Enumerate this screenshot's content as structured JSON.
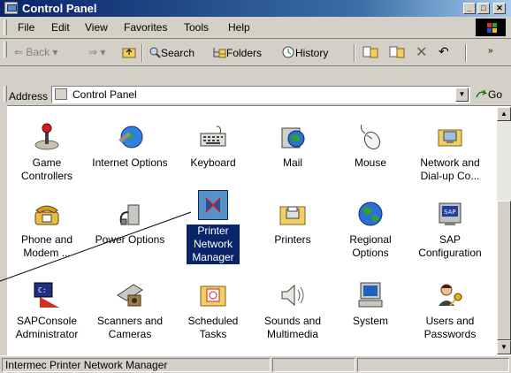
{
  "window": {
    "title": "Control Panel"
  },
  "menu": {
    "items": [
      "File",
      "Edit",
      "View",
      "Favorites",
      "Tools",
      "Help"
    ]
  },
  "toolbar": {
    "back": "Back",
    "search": "Search",
    "folders": "Folders",
    "history": "History"
  },
  "address": {
    "label": "Address",
    "value": "Control Panel",
    "go": "Go"
  },
  "icons": [
    {
      "name": "game-controllers",
      "label": "Game Controllers",
      "icon": "joystick-icon"
    },
    {
      "name": "internet-options",
      "label": "Internet Options",
      "icon": "globe-tools-icon"
    },
    {
      "name": "keyboard",
      "label": "Keyboard",
      "icon": "keyboard-icon"
    },
    {
      "name": "mail",
      "label": "Mail",
      "icon": "mail-icon"
    },
    {
      "name": "mouse",
      "label": "Mouse",
      "icon": "mouse-icon"
    },
    {
      "name": "network-dialup",
      "label": "Network and Dial-up Co...",
      "icon": "network-icon"
    },
    {
      "name": "phone-modem",
      "label": "Phone and Modem ...",
      "icon": "phone-icon"
    },
    {
      "name": "power-options",
      "label": "Power Options",
      "icon": "power-plug-icon"
    },
    {
      "name": "printer-network-manager",
      "label": "Printer Network Manager",
      "icon": "printer-network-manager-icon",
      "selected": true
    },
    {
      "name": "printers",
      "label": "Printers",
      "icon": "printer-folder-icon"
    },
    {
      "name": "regional-options",
      "label": "Regional Options",
      "icon": "globe-icon"
    },
    {
      "name": "sap-configuration",
      "label": "SAP Configuration",
      "icon": "sap-icon"
    },
    {
      "name": "sapconsole-administrator",
      "label": "SAPConsole Administrator",
      "icon": "console-icon"
    },
    {
      "name": "scanners-cameras",
      "label": "Scanners and Cameras",
      "icon": "scanner-icon"
    },
    {
      "name": "scheduled-tasks",
      "label": "Scheduled Tasks",
      "icon": "scheduled-tasks-icon"
    },
    {
      "name": "sounds-multimedia",
      "label": "Sounds and Multimedia",
      "icon": "speaker-icon"
    },
    {
      "name": "system",
      "label": "System",
      "icon": "computer-icon"
    },
    {
      "name": "users-passwords",
      "label": "Users and Passwords",
      "icon": "users-key-icon"
    }
  ],
  "status": {
    "text": "Intermec Printer Network Manager"
  },
  "colors": {
    "title_bar": "#0a246a",
    "selection": "#0a246a",
    "chrome": "#d4d0c8"
  }
}
